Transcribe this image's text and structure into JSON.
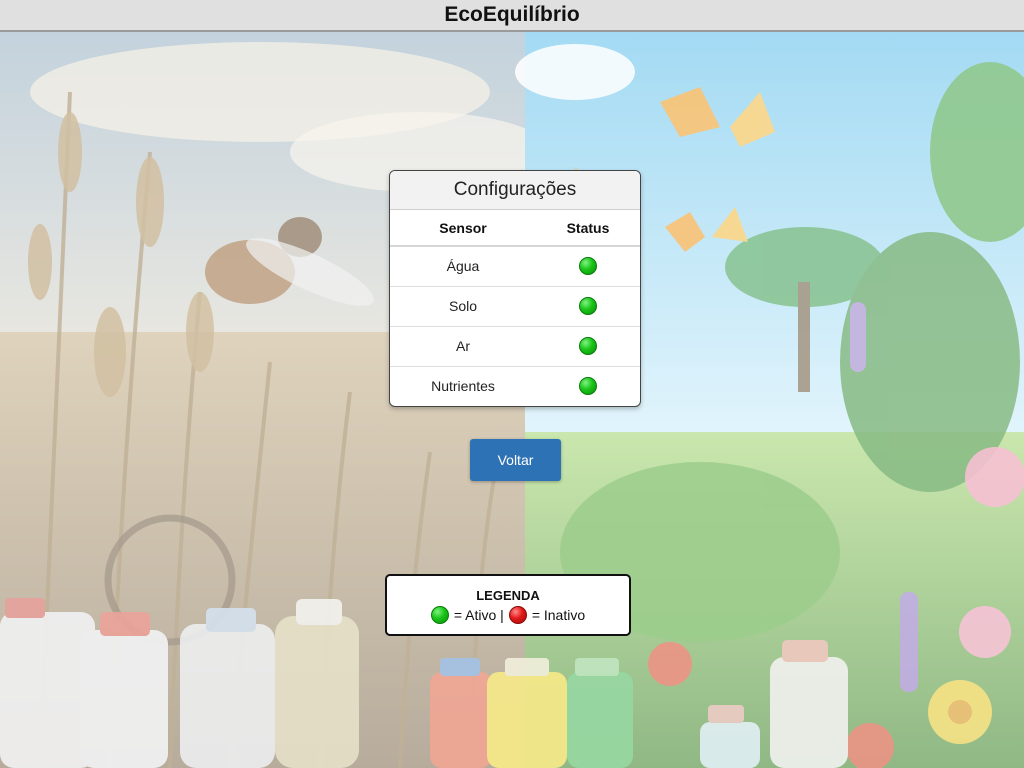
{
  "app": {
    "title": "EcoEquilíbrio"
  },
  "config_card": {
    "title": "Configurações",
    "headers": {
      "sensor": "Sensor",
      "status": "Status"
    },
    "rows": [
      {
        "sensor": "Água",
        "status": "green"
      },
      {
        "sensor": "Solo",
        "status": "green"
      },
      {
        "sensor": "Ar",
        "status": "green"
      },
      {
        "sensor": "Nutrientes",
        "status": "green"
      }
    ]
  },
  "back_button": {
    "label": "Voltar"
  },
  "legend": {
    "title": "LEGENDA",
    "active_text": "= Ativo |",
    "inactive_text": "= Inativo"
  },
  "colors": {
    "active": "#18c418",
    "inactive": "#e21818",
    "button": "#2d72b5"
  }
}
